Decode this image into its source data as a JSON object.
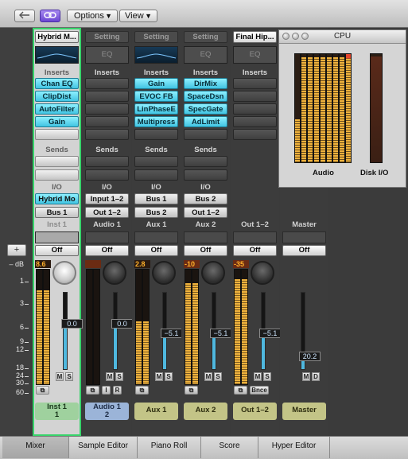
{
  "toolbar": {
    "back_icon": "back-arrow-icon",
    "link_icon": "link-icon",
    "options_label": "Options",
    "view_label": "View"
  },
  "scale": {
    "db_label": "– dB",
    "ticks": [
      "1",
      "3",
      "6",
      "9",
      "12",
      "18",
      "24",
      "30",
      "60"
    ]
  },
  "channels": [
    {
      "setting": "Hybrid M...",
      "setting_lit": true,
      "eq": "curve",
      "eq_label": "",
      "inserts_label": "Inserts",
      "inserts": [
        "Chan EQ",
        "ClipDist",
        "AutoFilter",
        "Gain"
      ],
      "sends_label": "Sends",
      "io_label": "I/O",
      "input": "Hybrid Mo",
      "output": "Bus 1",
      "name": "Inst 1",
      "automation": "Off",
      "peak": "8.6",
      "fader_value": "0.0",
      "ms": [
        "M",
        "S"
      ],
      "bottom": [
        "link-icon"
      ],
      "label_line1": "Inst 1",
      "label_line2": "1",
      "color": "green",
      "selected": true,
      "level": 0.82,
      "fader": 0.62
    },
    {
      "setting": "Setting",
      "setting_lit": false,
      "eq": "empty",
      "eq_label": "EQ",
      "inserts_label": "Inserts",
      "inserts": [],
      "sends_label": "Sends",
      "io_label": "I/O",
      "input": "Input 1–2",
      "output": "Out 1–2",
      "name": "Audio 1",
      "automation": "Off",
      "peak": "",
      "fader_value": "0.0",
      "ms": [
        "M",
        "S"
      ],
      "bottom": [
        "link-icon",
        "I",
        "R"
      ],
      "label_line1": "Audio 1",
      "label_line2": "2",
      "color": "blue",
      "selected": false,
      "level": 0,
      "fader": 0.62
    },
    {
      "setting": "Setting",
      "setting_lit": false,
      "eq": "curve",
      "eq_label": "",
      "inserts_label": "Inserts",
      "inserts": [
        "Gain",
        "EVOC FB",
        "LinPhaseE",
        "Multipress"
      ],
      "sends_label": "Sends",
      "io_label": "I/O",
      "input": "Bus 1",
      "output": "Bus 2",
      "name": "Aux 1",
      "automation": "Off",
      "peak": "2.8",
      "fader_value": "−5.1",
      "ms": [
        "M",
        "S"
      ],
      "bottom": [
        "link-icon"
      ],
      "label_line1": "Aux 1",
      "label_line2": "",
      "color": "olive",
      "selected": false,
      "level": 0.55,
      "fader": 0.5
    },
    {
      "setting": "Setting",
      "setting_lit": false,
      "eq": "empty",
      "eq_label": "EQ",
      "inserts_label": "Inserts",
      "inserts": [
        "DirMix",
        "SpaceDsn",
        "SpecGate",
        "AdLimit"
      ],
      "sends_label": "Sends",
      "io_label": "I/O",
      "input": "Bus 2",
      "output": "Out 1–2",
      "name": "Aux 2",
      "automation": "Off",
      "peak": "-10",
      "fader_value": "−5.1",
      "ms": [
        "M",
        "S"
      ],
      "bottom": [
        "link-icon"
      ],
      "label_line1": "Aux 2",
      "label_line2": "",
      "color": "olive",
      "selected": false,
      "level": 0.88,
      "fader": 0.5
    },
    {
      "setting": "Final Hip...",
      "setting_lit": true,
      "eq": "empty",
      "eq_label": "EQ",
      "inserts_label": "Inserts",
      "inserts": [],
      "sends_label": "",
      "io_label": "",
      "input": "",
      "output": "",
      "name": "Out 1–2",
      "automation": "Off",
      "peak": "-35",
      "fader_value": "−5.1",
      "ms": [
        "M",
        "S"
      ],
      "bottom": [
        "link-icon",
        "Bnce"
      ],
      "label_line1": "Out 1–2",
      "label_line2": "",
      "color": "olive",
      "selected": false,
      "level": 0.92,
      "fader": 0.5
    },
    {
      "setting": "",
      "setting_lit": false,
      "eq": "none",
      "eq_label": "",
      "inserts_label": "",
      "inserts": [],
      "sends_label": "",
      "io_label": "",
      "input": "",
      "output": "",
      "name": "Master",
      "automation": "Off",
      "peak": "",
      "fader_value": "20.2",
      "ms": [
        "M",
        "D"
      ],
      "bottom": [],
      "label_line1": "Master",
      "label_line2": "",
      "color": "olive",
      "selected": false,
      "level": 0,
      "fader": 0.2
    }
  ],
  "cpu_window": {
    "title": "CPU",
    "audio_label": "Audio",
    "disk_label": "Disk I/O",
    "core_levels": [
      0.4,
      0.97,
      0.97,
      0.97,
      0.97,
      0.97,
      0.97,
      0.97,
      1.0
    ],
    "disk_level": 0.98
  },
  "tabs": [
    "Mixer",
    "Sample Editor",
    "Piano Roll",
    "Score",
    "Hyper Editor"
  ],
  "active_tab": "Mixer"
}
